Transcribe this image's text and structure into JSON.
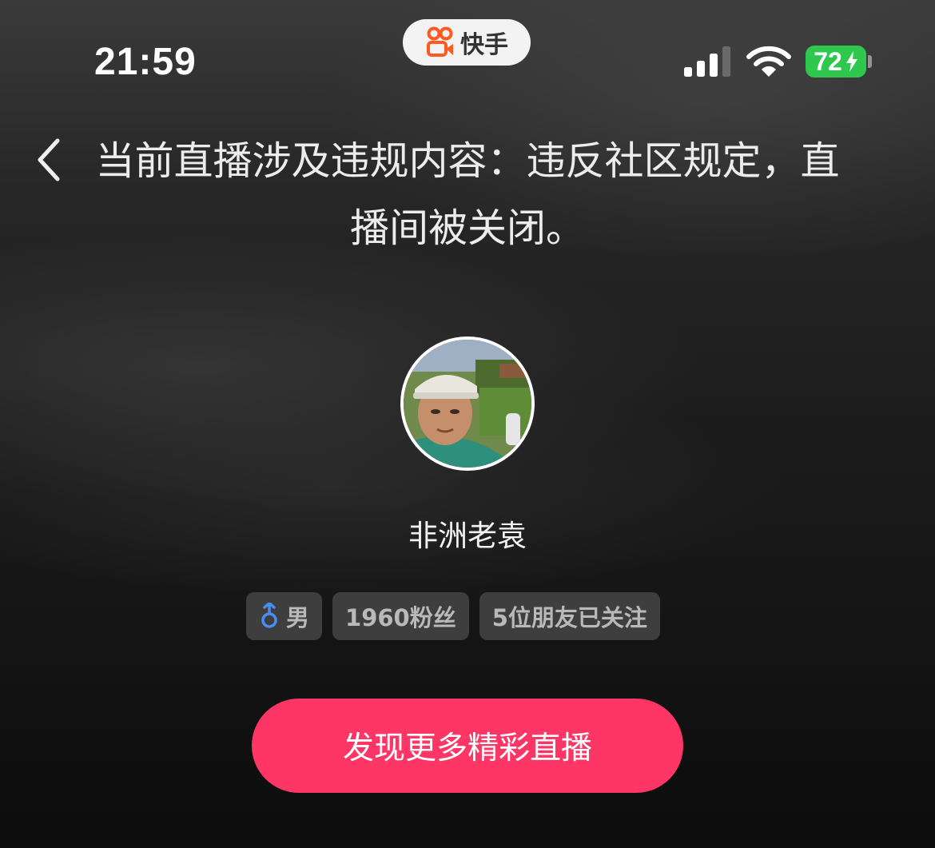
{
  "status_bar": {
    "time": "21:59",
    "app_name": "快手",
    "battery_level": "72",
    "signal_bars": 3,
    "battery_charging": true
  },
  "header": {
    "notice": "当前直播涉及违规内容：违反社区规定，直播间被关闭。"
  },
  "profile": {
    "username": "非洲老袁",
    "tags": {
      "gender": "男",
      "followers": "1960粉丝",
      "friends_following": "5位朋友已关注"
    },
    "gender_icon": "male-symbol-icon"
  },
  "cta": {
    "label": "发现更多精彩直播"
  },
  "colors": {
    "cta_background": "#fe3666",
    "battery": "#2fc84f",
    "brand_orange": "#ff5a1f",
    "gender_icon": "#4a8df0"
  }
}
